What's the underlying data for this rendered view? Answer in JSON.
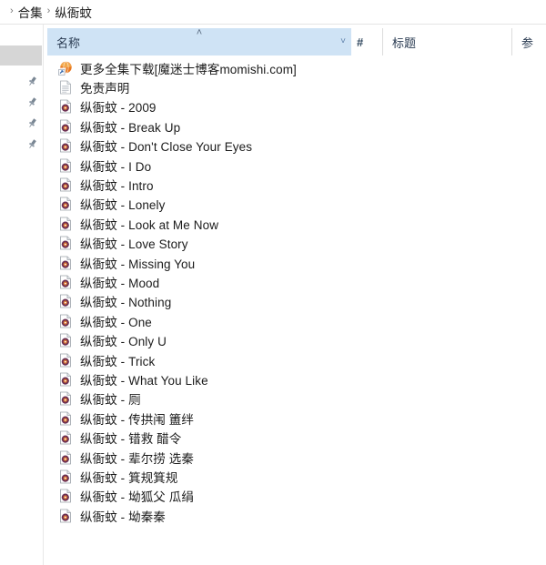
{
  "breadcrumb": {
    "separator": "›",
    "items": [
      {
        "label": "合集"
      },
      {
        "label": "纵衙蚊"
      }
    ]
  },
  "nav_rail": {
    "selected_block": {
      "name": "nav-selected-item"
    },
    "pins": [
      {
        "icon": "pin-icon"
      },
      {
        "icon": "pin-icon"
      },
      {
        "icon": "pin-icon"
      },
      {
        "icon": "pin-icon"
      }
    ]
  },
  "columns": {
    "name": {
      "label": "名称",
      "sort_caret": "˄",
      "dropdown_chevron": "˅"
    },
    "number": {
      "label": "#"
    },
    "title": {
      "label": "标题"
    },
    "extra": {
      "label": "参"
    }
  },
  "files": [
    {
      "icon": "internet-shortcut-icon",
      "name": "更多全集下载[魔迷士博客momishi.com]"
    },
    {
      "icon": "text-document-icon",
      "name": "免责声明"
    },
    {
      "icon": "audio-file-icon",
      "name": "纵衙蚊 - 2009"
    },
    {
      "icon": "audio-file-icon",
      "name": "纵衙蚊 - Break Up"
    },
    {
      "icon": "audio-file-icon",
      "name": "纵衙蚊 - Don't Close Your Eyes"
    },
    {
      "icon": "audio-file-icon",
      "name": "纵衙蚊 - I Do"
    },
    {
      "icon": "audio-file-icon",
      "name": "纵衙蚊 - Intro"
    },
    {
      "icon": "audio-file-icon",
      "name": "纵衙蚊 - Lonely"
    },
    {
      "icon": "audio-file-icon",
      "name": "纵衙蚊 - Look at Me Now"
    },
    {
      "icon": "audio-file-icon",
      "name": "纵衙蚊 - Love Story"
    },
    {
      "icon": "audio-file-icon",
      "name": "纵衙蚊 - Missing You"
    },
    {
      "icon": "audio-file-icon",
      "name": "纵衙蚊 - Mood"
    },
    {
      "icon": "audio-file-icon",
      "name": "纵衙蚊 - Nothing"
    },
    {
      "icon": "audio-file-icon",
      "name": "纵衙蚊 - One"
    },
    {
      "icon": "audio-file-icon",
      "name": "纵衙蚊 - Only U"
    },
    {
      "icon": "audio-file-icon",
      "name": "纵衙蚊 - Trick"
    },
    {
      "icon": "audio-file-icon",
      "name": "纵衙蚊 - What You Like"
    },
    {
      "icon": "audio-file-icon",
      "name": "纵衙蚊 - 厕"
    },
    {
      "icon": "audio-file-icon",
      "name": "纵衙蚊 - 传拱闱 簠绊"
    },
    {
      "icon": "audio-file-icon",
      "name": "纵衙蚊 - 错救 醋令"
    },
    {
      "icon": "audio-file-icon",
      "name": "纵衙蚊 - 辈尔捞 选秦"
    },
    {
      "icon": "audio-file-icon",
      "name": "纵衙蚊 - 箕规箕规"
    },
    {
      "icon": "audio-file-icon",
      "name": "纵衙蚊 - 坳狐父 瓜绢"
    },
    {
      "icon": "audio-file-icon",
      "name": "纵衙蚊 - 坳秦秦"
    }
  ],
  "colors": {
    "header_fill": "#cfe3f5",
    "header_text": "#2a3b52",
    "nav_selected": "#d6d6d6",
    "pin_gray": "#7a8794",
    "divider": "#e8e8e8"
  }
}
